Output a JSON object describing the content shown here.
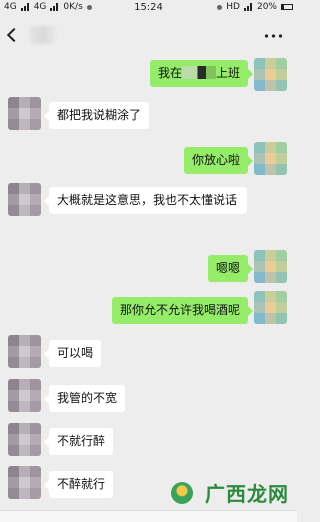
{
  "status_bar": {
    "left": [
      "4G",
      "4G",
      "0K/s"
    ],
    "time": "15:24",
    "right": [
      "HD",
      "20%"
    ]
  },
  "chat": {
    "messages": [
      {
        "from": "me",
        "text_before": "我在",
        "text_after": "上班"
      },
      {
        "from": "them",
        "text": "都把我说糊涂了"
      },
      {
        "from": "me",
        "text": "你放心啦"
      },
      {
        "from": "them",
        "text": "大概就是这意思，我也不太懂说话"
      },
      {
        "from": "me",
        "text": "嗯嗯"
      },
      {
        "from": "me",
        "text": "那你允不允许我喝酒呢"
      },
      {
        "from": "them",
        "text": "可以喝"
      },
      {
        "from": "them",
        "text": "我管的不宽"
      },
      {
        "from": "them",
        "text": "不就行醉"
      },
      {
        "from": "them",
        "text": "不醉就行"
      }
    ]
  },
  "watermark": {
    "text": "广西龙网"
  },
  "colors": {
    "background": "#ededed",
    "my_bubble": "#95ec69",
    "their_bubble": "#ffffff"
  },
  "icons": [
    "back-arrow-icon",
    "more-icon",
    "signal-icon",
    "battery-icon"
  ]
}
